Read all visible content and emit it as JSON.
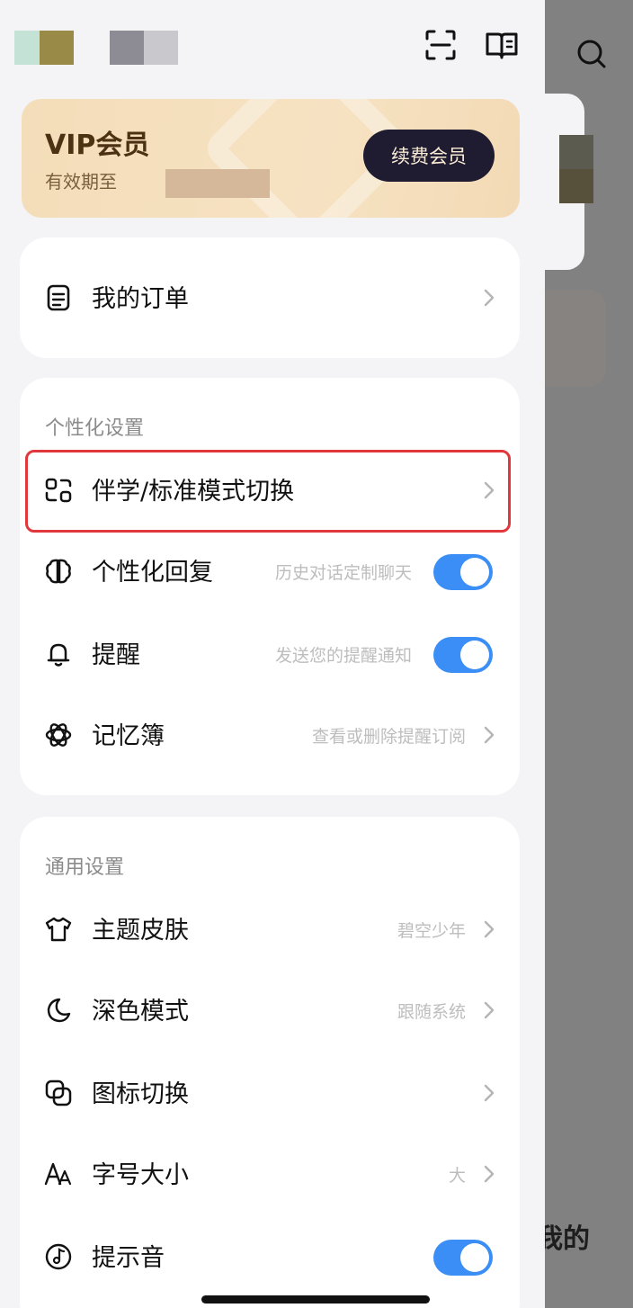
{
  "background": {
    "partial_text": "我的"
  },
  "topbar": {
    "scan_icon": "scan-icon",
    "book_icon": "book-icon"
  },
  "vip": {
    "title": "VIP会员",
    "validity_label": "有效期至",
    "renew_button": "续费会员"
  },
  "orders": {
    "label": "我的订单"
  },
  "personalization": {
    "section_title": "个性化设置",
    "items": [
      {
        "label": "伴学/标准模式切换",
        "hint": "",
        "control": "chevron"
      },
      {
        "label": "个性化回复",
        "hint": "历史对话定制聊天",
        "control": "toggle",
        "on": true
      },
      {
        "label": "提醒",
        "hint": "发送您的提醒通知",
        "control": "toggle",
        "on": true
      },
      {
        "label": "记忆簿",
        "hint": "查看或删除提醒订阅",
        "control": "chevron"
      }
    ]
  },
  "general": {
    "section_title": "通用设置",
    "items": [
      {
        "label": "主题皮肤",
        "hint": "碧空少年",
        "control": "chevron"
      },
      {
        "label": "深色模式",
        "hint": "跟随系统",
        "control": "chevron"
      },
      {
        "label": "图标切换",
        "hint": "",
        "control": "chevron"
      },
      {
        "label": "字号大小",
        "hint": "大",
        "control": "chevron"
      },
      {
        "label": "提示音",
        "hint": "",
        "control": "toggle",
        "on": true
      }
    ]
  },
  "colors": {
    "accent": "#3a8ef5",
    "highlight_border": "#e0383c",
    "vip_button": "#1f1b30"
  }
}
